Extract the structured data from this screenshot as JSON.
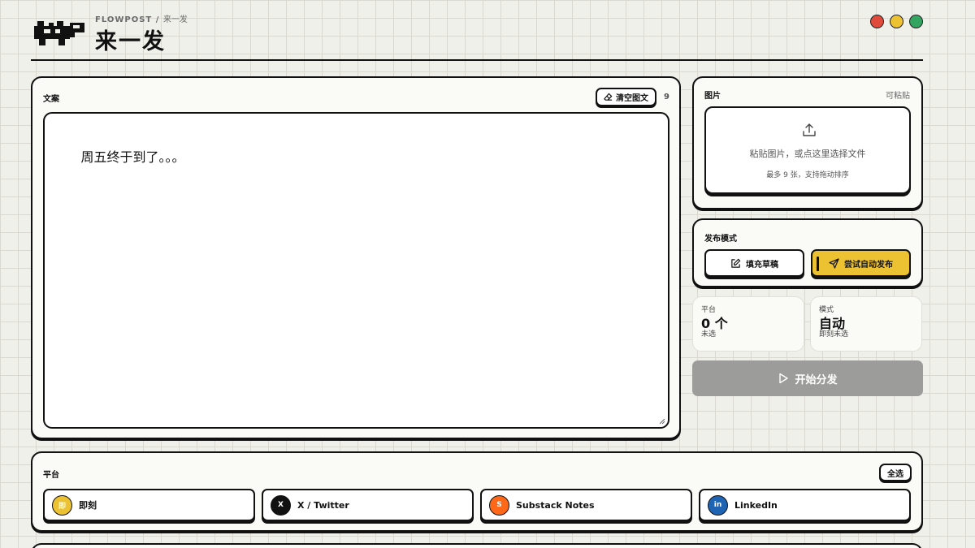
{
  "header": {
    "brand": "FLOWPOST",
    "breadcrumb_sep": " / ",
    "breadcrumb_page": "来一发",
    "title": "来一发",
    "logo_icon": "pixel-truck-icon",
    "window_controls": [
      "red",
      "yellow",
      "green"
    ]
  },
  "caption": {
    "label": "文案",
    "clear_label": "清空图文",
    "clear_icon": "eraser-icon",
    "char_count": "9",
    "text": "周五终于到了。。。"
  },
  "images": {
    "label": "图片",
    "paste_hint": "可粘贴",
    "upload_icon": "upload-icon",
    "drop_text": "粘贴图片，或点这里选择文件",
    "drop_sub": "最多 9 张，支持拖动排序"
  },
  "publish_mode": {
    "label": "发布模式",
    "draft_label": "填充草稿",
    "draft_icon": "edit-icon",
    "auto_label": "尝试自动发布",
    "auto_icon": "send-icon"
  },
  "stats": {
    "platform": {
      "label": "平台",
      "value": "0 个",
      "sub": "未选"
    },
    "mode": {
      "label": "模式",
      "value": "自动",
      "sub": "即刻未选"
    }
  },
  "start": {
    "label": "开始分发",
    "icon": "play-icon"
  },
  "platforms": {
    "label": "平台",
    "select_all": "全选",
    "items": [
      {
        "name": "即刻",
        "badge": "即",
        "color": "#edc232",
        "text_color": "#ffffff"
      },
      {
        "name": "X / Twitter",
        "badge": "X",
        "color": "#111111",
        "text_color": "#ffffff"
      },
      {
        "name": "Substack Notes",
        "badge": "S",
        "color": "#ff6719",
        "text_color": "#ffffff"
      },
      {
        "name": "LinkedIn",
        "badge": "in",
        "color": "#1f64b3",
        "text_color": "#ffffff"
      }
    ]
  },
  "colors": {
    "accent": "#edc232",
    "ink": "#111111",
    "disabled": "#9c9c9a",
    "background": "#f0f0ea"
  }
}
